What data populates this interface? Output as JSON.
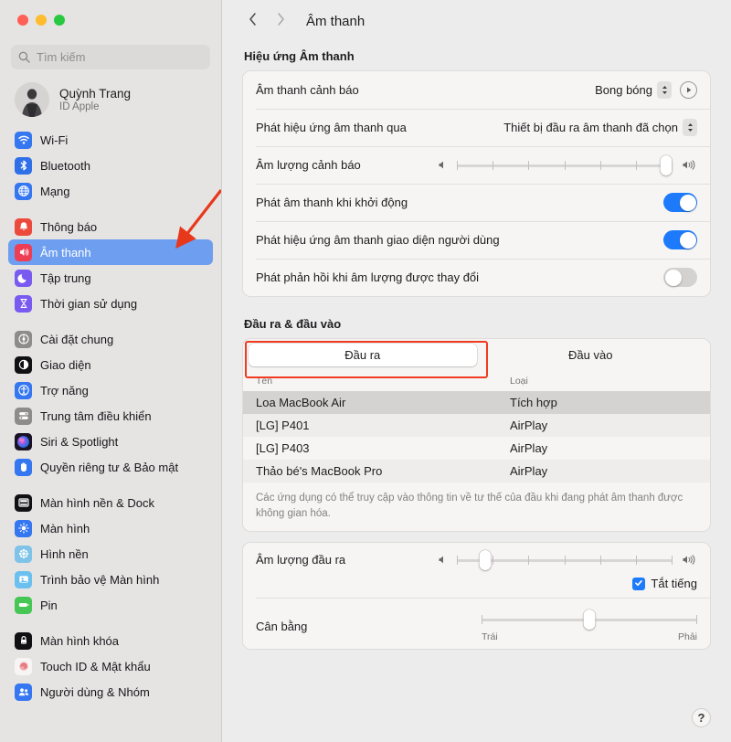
{
  "window": {
    "traffic_lights": [
      "close",
      "minimize",
      "maximize"
    ],
    "colors": {
      "accent": "#1d7bfb",
      "selection": "#6d9ef0",
      "annotation": "#f03b20"
    }
  },
  "sidebar": {
    "search": {
      "placeholder": "Tìm kiếm",
      "icon": "search-icon"
    },
    "account": {
      "name": "Quỳnh Trang",
      "subtitle": "ID Apple",
      "avatar": "user-avatar"
    },
    "groups": [
      {
        "items": [
          {
            "label": "Wi-Fi",
            "icon": "wifi-icon",
            "selected": false
          },
          {
            "label": "Bluetooth",
            "icon": "bluetooth-icon",
            "selected": false
          },
          {
            "label": "Mạng",
            "icon": "network-globe-icon",
            "selected": false
          }
        ]
      },
      {
        "items": [
          {
            "label": "Thông báo",
            "icon": "bell-icon",
            "selected": false
          },
          {
            "label": "Âm thanh",
            "icon": "speaker-icon",
            "selected": true
          },
          {
            "label": "Tập trung",
            "icon": "moon-icon",
            "selected": false
          },
          {
            "label": "Thời gian sử dụng",
            "icon": "hourglass-icon",
            "selected": false
          }
        ]
      },
      {
        "items": [
          {
            "label": "Cài đặt chung",
            "icon": "gear-icon",
            "selected": false
          },
          {
            "label": "Giao diện",
            "icon": "appearance-icon",
            "selected": false
          },
          {
            "label": "Trợ năng",
            "icon": "accessibility-icon",
            "selected": false
          },
          {
            "label": "Trung tâm điều khiển",
            "icon": "control-center-icon",
            "selected": false
          },
          {
            "label": "Siri & Spotlight",
            "icon": "siri-icon",
            "selected": false
          },
          {
            "label": "Quyền riêng tư & Bảo mật",
            "icon": "privacy-hand-icon",
            "selected": false
          }
        ]
      },
      {
        "items": [
          {
            "label": "Màn hình nền & Dock",
            "icon": "desktop-dock-icon",
            "selected": false
          },
          {
            "label": "Màn hình",
            "icon": "display-brightness-icon",
            "selected": false
          },
          {
            "label": "Hình nền",
            "icon": "wallpaper-icon",
            "selected": false
          },
          {
            "label": "Trình bảo vệ Màn hình",
            "icon": "screensaver-icon",
            "selected": false
          },
          {
            "label": "Pin",
            "icon": "battery-icon",
            "selected": false
          }
        ]
      },
      {
        "items": [
          {
            "label": "Màn hình khóa",
            "icon": "lock-screen-icon",
            "selected": false
          },
          {
            "label": "Touch ID & Mật khẩu",
            "icon": "touchid-icon",
            "selected": false
          },
          {
            "label": "Người dùng & Nhóm",
            "icon": "users-groups-icon",
            "selected": false
          }
        ]
      }
    ]
  },
  "toolbar": {
    "back_icon": "chevron-left-icon",
    "forward_icon": "chevron-right-icon",
    "title": "Âm thanh"
  },
  "sound_effects": {
    "section_title": "Hiệu ứng Âm thanh",
    "alert_sound": {
      "label": "Âm thanh cảnh báo",
      "value": "Bong bóng",
      "play_icon": "play-icon"
    },
    "play_through": {
      "label": "Phát hiệu ứng âm thanh qua",
      "value": "Thiết bị đầu ra âm thanh đã chọn"
    },
    "alert_volume": {
      "label": "Âm lượng cảnh báo",
      "value_percent": 97,
      "tick_count": 6
    },
    "startup_sound": {
      "label": "Phát âm thanh khi khởi động",
      "on": true
    },
    "ui_sound_effects": {
      "label": "Phát hiệu ứng âm thanh giao diện người dùng",
      "on": true
    },
    "volume_feedback": {
      "label": "Phát phản hồi khi âm lượng được thay đổi",
      "on": false
    }
  },
  "output_input": {
    "section_title": "Đầu ra & đầu vào",
    "tabs": [
      {
        "label": "Đầu ra",
        "active": true,
        "highlighted": true
      },
      {
        "label": "Đầu vào",
        "active": false,
        "highlighted": false
      }
    ],
    "table": {
      "headers": [
        "Tên",
        "Loại"
      ],
      "rows": [
        {
          "name": "Loa MacBook Air",
          "type": "Tích hợp",
          "selected": true
        },
        {
          "name": "[LG] P401",
          "type": "AirPlay",
          "selected": false
        },
        {
          "name": "[LG] P403",
          "type": "AirPlay",
          "selected": false
        },
        {
          "name": "Thảo bé's MacBook Pro",
          "type": "AirPlay",
          "selected": false
        }
      ],
      "note": "Các ứng dụng có thể truy cập vào thông tin về tư thế của đầu khi đang phát âm thanh được không gian hóa."
    },
    "output_volume": {
      "label": "Âm lượng đầu ra",
      "value_percent": 13,
      "tick_count": 6
    },
    "mute": {
      "label": "Tắt tiếng",
      "checked": true,
      "icon": "checkmark-icon"
    },
    "balance": {
      "label": "Cân bằng",
      "value_percent": 50,
      "left_label": "Trái",
      "right_label": "Phải"
    }
  },
  "help": {
    "label": "?",
    "icon": "help-icon"
  }
}
